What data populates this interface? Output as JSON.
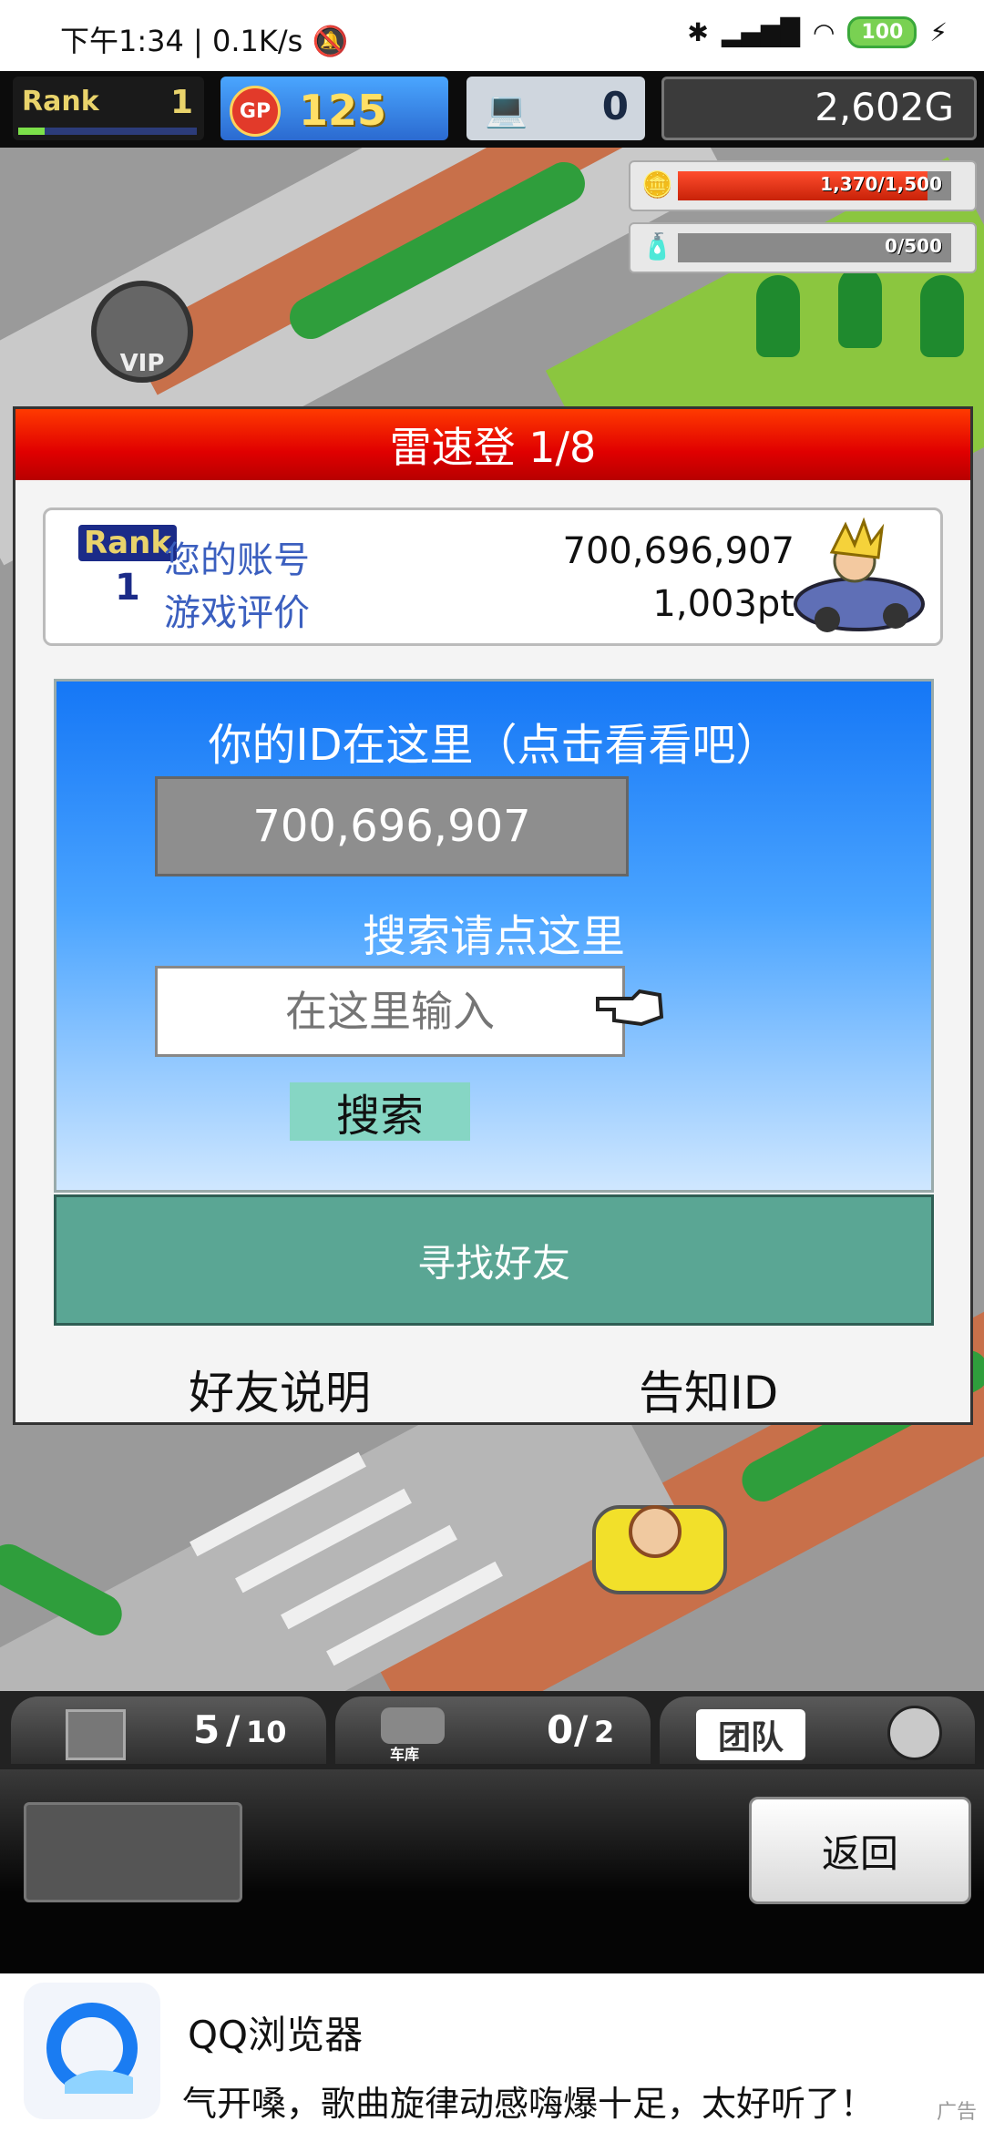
{
  "status_bar": {
    "time": "下午1:34",
    "net_speed": "0.1K/s",
    "battery": "100"
  },
  "hud": {
    "rank_label": "Rank",
    "rank_value": "1",
    "rank_progress": 0.15,
    "gp_label": "GP",
    "gp_value": "125",
    "pc_value": "0",
    "money": "2,602G"
  },
  "resources": [
    {
      "icon": "coins-icon",
      "label": "1,370/1,500",
      "fill": 0.913
    },
    {
      "icon": "fuel-icon",
      "label": "0/500",
      "fill": 0
    }
  ],
  "game_labels": {
    "vip": "VIP"
  },
  "dialog": {
    "title": "雷速登 1/8",
    "account": {
      "rank_label": "Rank",
      "rank_value": "1",
      "account_label": "您的账号",
      "account_value": "700,696,907",
      "rating_label": "游戏评价",
      "rating_value": "1,003pt"
    },
    "id_heading": "你的ID在这里（点击看看吧）",
    "id_value": "700,696,907",
    "search_heading": "搜索请点这里",
    "search_placeholder": "在这里输入",
    "search_button": "搜索",
    "find_friends": "寻找好友",
    "friend_help": "好友说明",
    "notify_id": "告知ID"
  },
  "bottom_tabs": {
    "items": "5",
    "items_max": "10",
    "garage_label": "车库",
    "garage": "0",
    "garage_max": "2",
    "team_label": "团队"
  },
  "back_button": "返回",
  "ad": {
    "title": "QQ浏览器",
    "text": "气开嗓，歌曲旋律动感嗨爆十足，太好听了！",
    "label": "广告"
  },
  "colors": {
    "title_red": "#e00000",
    "panel_blue": "#1577f6",
    "find_green": "#5aa694",
    "search_btn": "#86d6c4"
  }
}
